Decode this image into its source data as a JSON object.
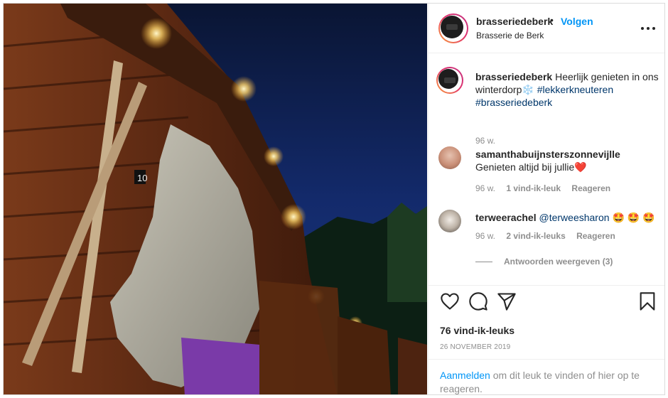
{
  "post": {
    "username": "brasseriedeberk",
    "separator": "•",
    "follow_label": "Volgen",
    "location": "Brasserie de Berk",
    "avatar_text": "DE BERK",
    "more_icon": "more-options-icon"
  },
  "caption": {
    "username": "brasseriedeberk",
    "text": "Heerlijk genieten in ons winterdorp",
    "emoji": "❄️",
    "hashtags": [
      "#lekkerkneuteren",
      "#brasseriedeberk"
    ],
    "age": "96 w."
  },
  "comments": [
    {
      "username": "samanthabuijnsterszonnevijlle",
      "text": "Genieten altijd bij jullie",
      "emoji": "❤️",
      "age": "96 w.",
      "likes": "1 vind-ik-leuk",
      "reply_label": "Reageren"
    },
    {
      "username": "terweerachel",
      "mention": "@terweesharon",
      "emoji": "🤩 🤩 🤩",
      "age": "96 w.",
      "likes": "2 vind-ik-leuks",
      "reply_label": "Reageren"
    }
  ],
  "replies_label": "Antwoorden weergeven (3)",
  "actions": {
    "icons": [
      "heart-icon",
      "comment-icon",
      "share-icon",
      "bookmark-icon"
    ],
    "likes_count": "76 vind-ik-leuks",
    "date": "26 NOVEMBER 2019"
  },
  "login_prompt": {
    "link": "Aanmelden",
    "text": "om dit leuk te vinden of hier op te reageren."
  },
  "photo": {
    "sign_number": "10"
  }
}
